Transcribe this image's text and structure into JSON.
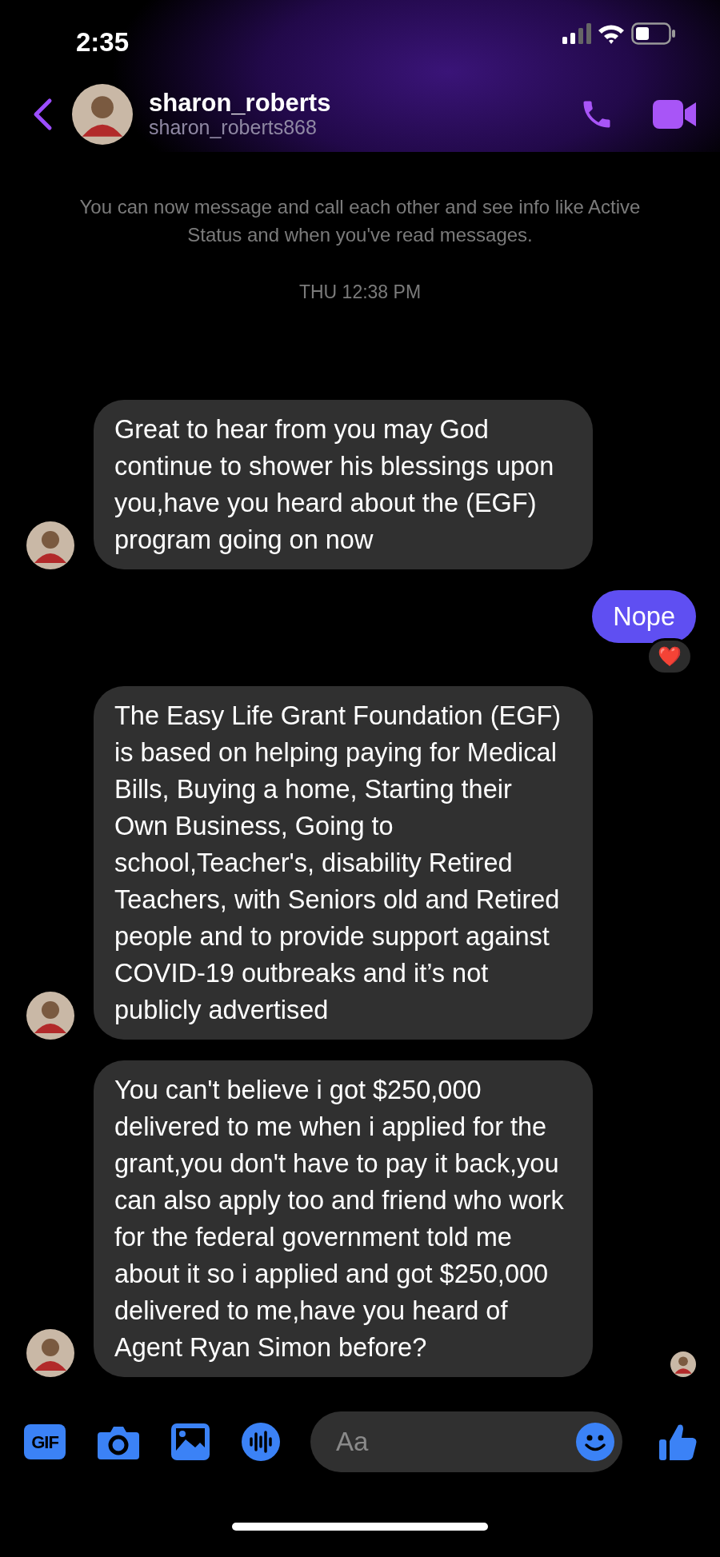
{
  "status_bar": {
    "time": "2:35"
  },
  "header": {
    "name": "sharon_roberts",
    "username": "sharon_roberts868"
  },
  "notice": "You can now message and call each other and see info like Active Status and when you've read messages.",
  "timestamp": "THU 12:38 PM",
  "messages": [
    {
      "kind": "incoming",
      "text": "Great to hear from you may God continue to shower his blessings upon you,have you heard about the (EGF) program going on now",
      "show_avatar": true
    },
    {
      "kind": "outgoing",
      "text": "Nope",
      "reaction": "❤️"
    },
    {
      "kind": "incoming",
      "text": "The Easy Life Grant Foundation (EGF)  is based on helping paying for Medical Bills, Buying a home, Starting their Own Business, Going to school,Teacher's, disability Retired Teachers, with Seniors old and Retired people and to provide support against COVID-19 outbreaks and it’s not publicly advertised",
      "show_avatar": true
    },
    {
      "kind": "incoming",
      "text": "You can't believe i got $250,000 delivered to me when i applied for the grant,you don't have to pay it back,you  can also apply too and friend who work for the federal government told me about it so i applied and got $250,000 delivered to me,have you heard of Agent Ryan Simon  before?",
      "show_avatar": true,
      "seen": true
    }
  ],
  "composer": {
    "gif_label": "GIF",
    "placeholder": "Aa"
  }
}
